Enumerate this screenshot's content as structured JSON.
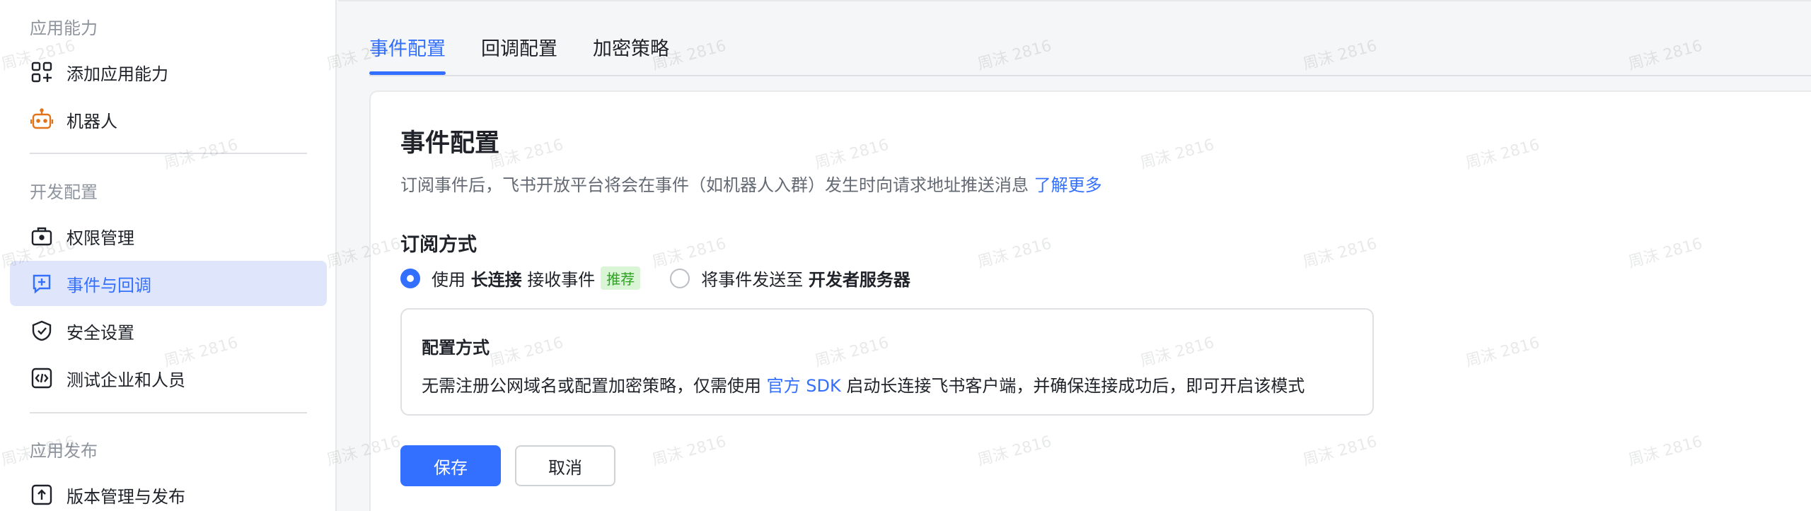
{
  "sidebar": {
    "sections": {
      "app_capability": "应用能力",
      "dev_config": "开发配置",
      "app_release": "应用发布"
    },
    "items": [
      {
        "label": "添加应用能力"
      },
      {
        "label": "机器人"
      },
      {
        "label": "权限管理"
      },
      {
        "label": "事件与回调"
      },
      {
        "label": "安全设置"
      },
      {
        "label": "测试企业和人员"
      },
      {
        "label": "版本管理与发布"
      }
    ],
    "active_index": 3
  },
  "tabs": [
    {
      "label": "事件配置"
    },
    {
      "label": "回调配置"
    },
    {
      "label": "加密策略"
    }
  ],
  "card": {
    "title": "事件配置",
    "desc": "订阅事件后，飞书开放平台将会在事件（如机器人入群）发生时向请求地址推送消息",
    "desc_link": "了解更多",
    "subscribe_title": "订阅方式",
    "option1": {
      "prefix": "使用",
      "bold": "长连接",
      "suffix": "接收事件",
      "tag": "推荐"
    },
    "option2": {
      "prefix": "将事件发送至",
      "bold": "开发者服务器"
    },
    "info": {
      "title": "配置方式",
      "text_before": "无需注册公网域名或配置加密策略，仅需使用",
      "link": "官方 SDK",
      "text_after": "启动长连接飞书客户端，并确保连接成功后，即可开启该模式"
    },
    "save_label": "保存",
    "cancel_label": "取消"
  },
  "watermark": "周沫 2816",
  "colors": {
    "accent": "#3370ff",
    "active_bg": "#dfe5fb",
    "tag_bg": "#d9f5d6",
    "tag_text": "#2ea121"
  }
}
